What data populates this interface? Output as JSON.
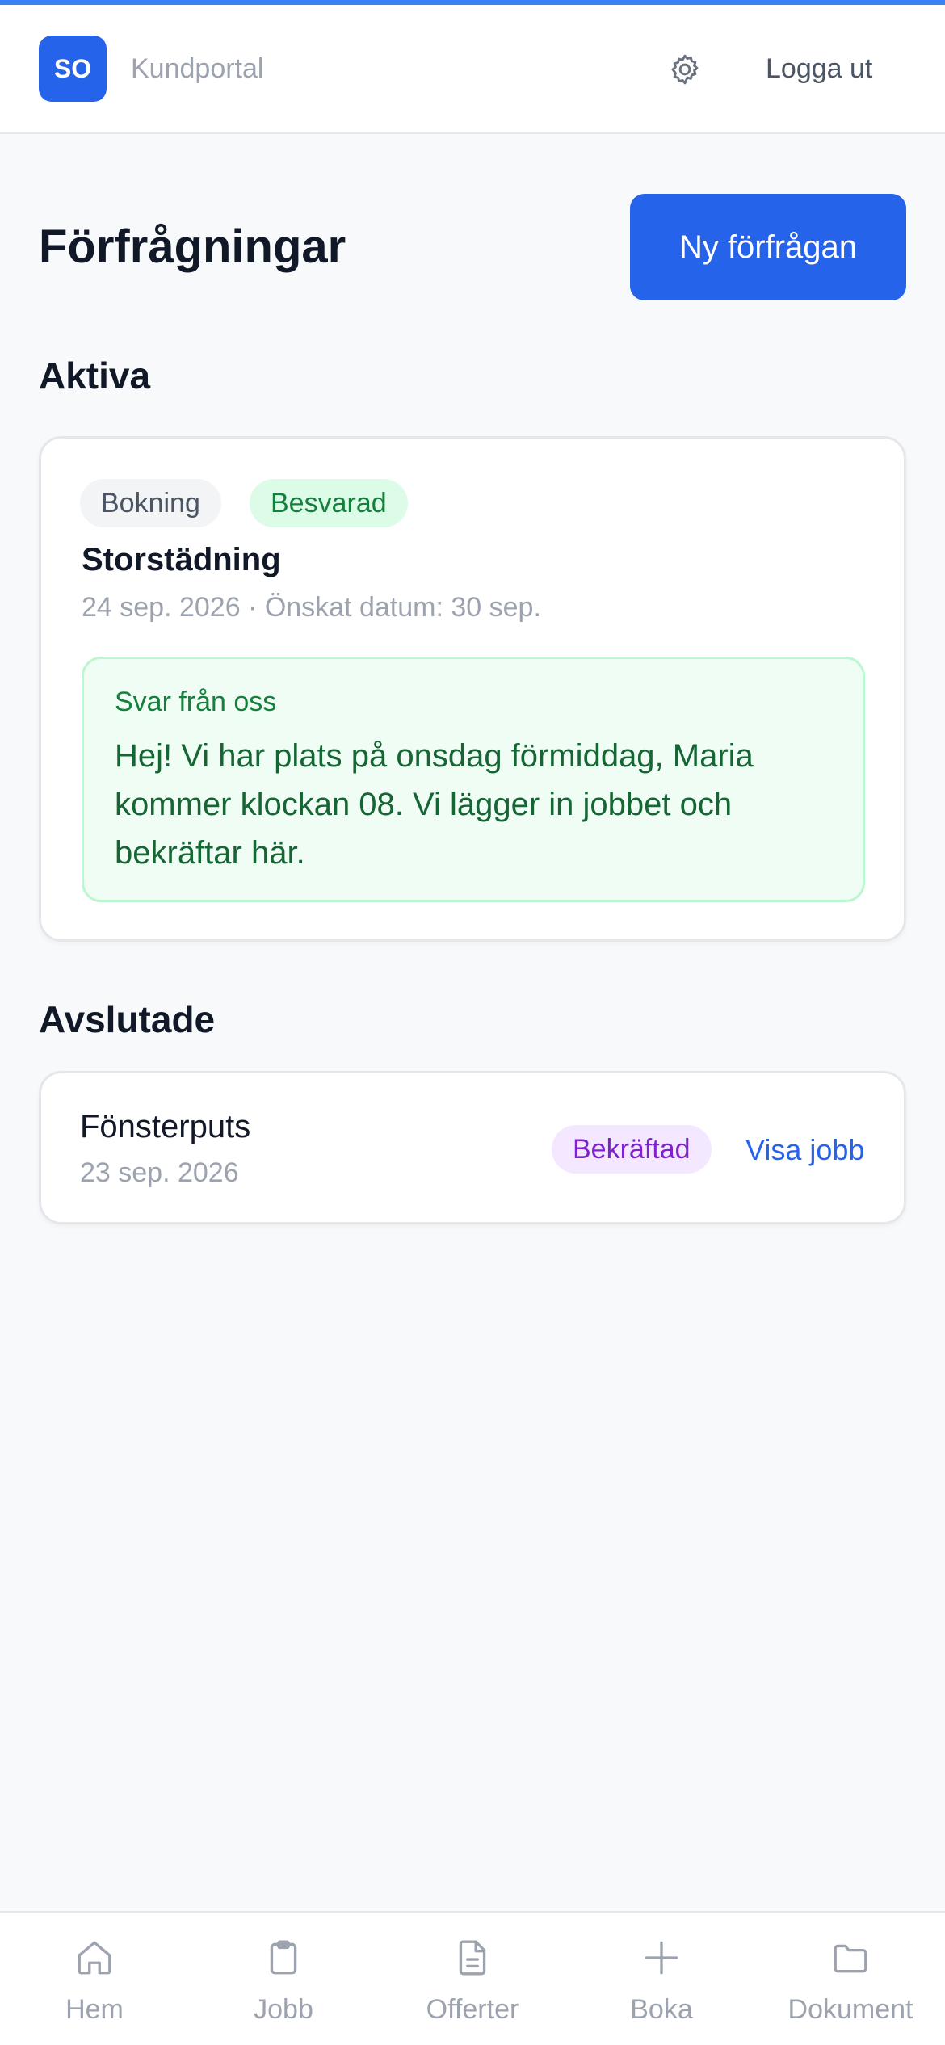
{
  "header": {
    "logo_initials": "SO",
    "portal_name": "Kundportal",
    "settings_icon": "gear-icon",
    "logout_label": "Logga ut"
  },
  "page": {
    "title": "Förfrågningar",
    "new_request_label": "Ny förfrågan"
  },
  "active": {
    "section_title": "Aktiva",
    "items": [
      {
        "type_badge": "Bokning",
        "status_badge": "Besvarad",
        "title": "Storstädning",
        "meta": "24 sep. 2026 · Önskat datum: 30 sep.",
        "reply_heading": "Svar från oss",
        "reply_text": "Hej! Vi har plats på onsdag förmiddag, Maria kommer klockan 08. Vi lägger in jobbet och bekräftar här."
      }
    ]
  },
  "finished": {
    "section_title": "Avslutade",
    "items": [
      {
        "title": "Fönsterputs",
        "date": "23 sep. 2026",
        "status_badge": "Bekräftad",
        "link_label": "Visa jobb"
      }
    ]
  },
  "tabbar": {
    "items": [
      {
        "label": "Hem",
        "icon": "home-icon"
      },
      {
        "label": "Jobb",
        "icon": "clipboard-icon"
      },
      {
        "label": "Offerter",
        "icon": "document-icon"
      },
      {
        "label": "Boka",
        "icon": "plus-icon"
      },
      {
        "label": "Dokument",
        "icon": "folder-icon"
      }
    ]
  },
  "colors": {
    "accent": "#2563eb",
    "success": "#15803d",
    "confirmed": "#7e22ce",
    "muted": "#9ca3af"
  }
}
